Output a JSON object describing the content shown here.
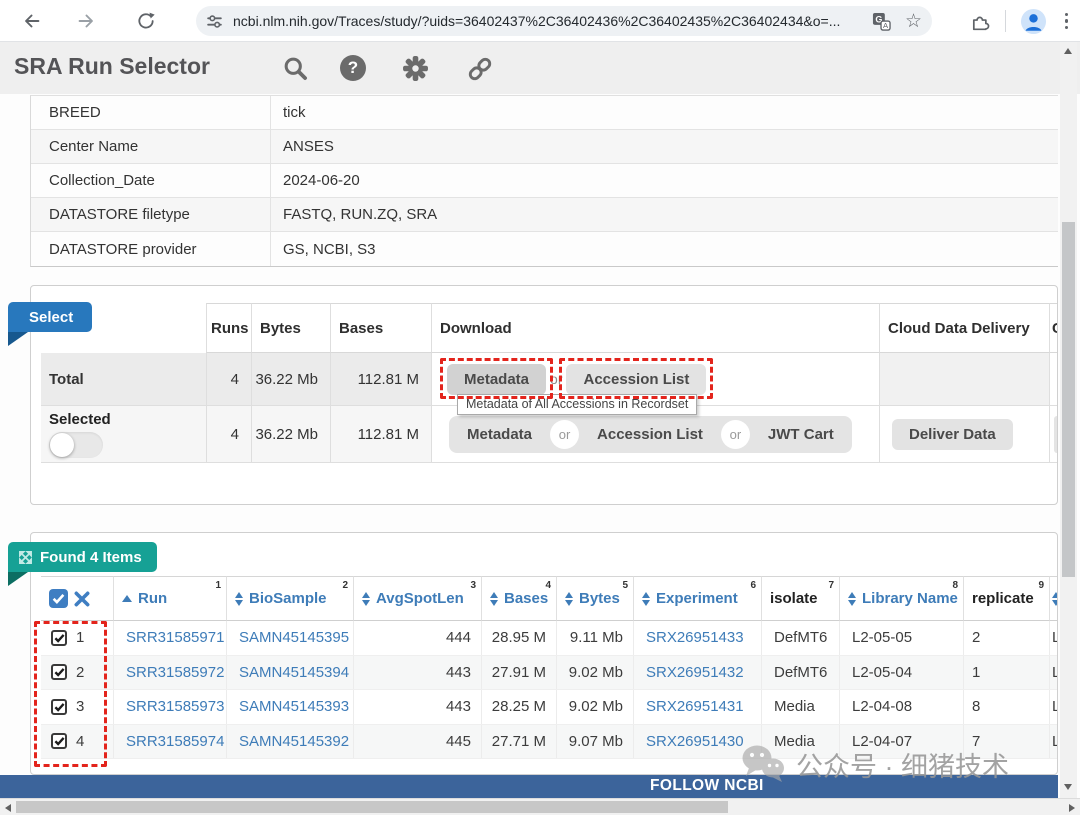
{
  "browser": {
    "url": "ncbi.nlm.nih.gov/Traces/study/?uids=36402437%2C36402436%2C36402435%2C36402434&o=...",
    "star_glyph": "☆"
  },
  "app_header": {
    "title": "SRA Run Selector",
    "help_glyph": "?"
  },
  "metadata_table": {
    "rows": [
      {
        "name": "BREED",
        "value": "tick"
      },
      {
        "name": "Center Name",
        "value": "ANSES"
      },
      {
        "name": "Collection_Date",
        "value": "2024-06-20"
      },
      {
        "name": "DATASTORE filetype",
        "value": "FASTQ, RUN.ZQ, SRA"
      },
      {
        "name": "DATASTORE provider",
        "value": "GS, NCBI, S3"
      }
    ]
  },
  "select_panel": {
    "ribbon": "Select",
    "headers": {
      "runs": "Runs",
      "bytes": "Bytes",
      "bases": "Bases",
      "download": "Download",
      "cloud": "Cloud Data Delivery",
      "partial": "C"
    },
    "total": {
      "label": "Total",
      "runs": "4",
      "bytes": "36.22 Mb",
      "bases": "112.81 M"
    },
    "selected": {
      "label": "Selected",
      "runs": "4",
      "bytes": "36.22 Mb",
      "bases": "112.81 M"
    },
    "buttons": {
      "metadata": "Metadata",
      "accession_list": "Accession List",
      "jwt_cart": "JWT Cart",
      "deliver_data": "Deliver Data",
      "or": "or"
    },
    "tooltip": "Metadata of All Accessions in Recordset"
  },
  "results_panel": {
    "ribbon": "Found 4 Items",
    "columns": [
      {
        "label": "Run",
        "sup": "1"
      },
      {
        "label": "BioSample",
        "sup": "2"
      },
      {
        "label": "AvgSpotLen",
        "sup": "3"
      },
      {
        "label": "Bases",
        "sup": "4"
      },
      {
        "label": "Bytes",
        "sup": "5"
      },
      {
        "label": "Experiment",
        "sup": "6"
      },
      {
        "label": "isolate",
        "sup": "7"
      },
      {
        "label": "Library Name",
        "sup": "8"
      },
      {
        "label": "replicate",
        "sup": "9"
      }
    ],
    "rows": [
      {
        "num": "1",
        "run": "SRR31585971",
        "biosample": "SAMN45145395",
        "avgspotlen": "444",
        "bases": "28.95 M",
        "bytes": "9.11 Mb",
        "experiment": "SRX26951433",
        "isolate": "DefMT6",
        "library_name": "L2-05-05",
        "replicate": "2",
        "clipped": "L"
      },
      {
        "num": "2",
        "run": "SRR31585972",
        "biosample": "SAMN45145394",
        "avgspotlen": "443",
        "bases": "27.91 M",
        "bytes": "9.02 Mb",
        "experiment": "SRX26951432",
        "isolate": "DefMT6",
        "library_name": "L2-05-04",
        "replicate": "1",
        "clipped": "L"
      },
      {
        "num": "3",
        "run": "SRR31585973",
        "biosample": "SAMN45145393",
        "avgspotlen": "443",
        "bases": "28.25 M",
        "bytes": "9.02 Mb",
        "experiment": "SRX26951431",
        "isolate": "Media",
        "library_name": "L2-04-08",
        "replicate": "8",
        "clipped": "L"
      },
      {
        "num": "4",
        "run": "SRR31585974",
        "biosample": "SAMN45145392",
        "avgspotlen": "445",
        "bases": "27.71 M",
        "bytes": "9.07 Mb",
        "experiment": "SRX26951430",
        "isolate": "Media",
        "library_name": "L2-04-07",
        "replicate": "7",
        "clipped": "L"
      }
    ]
  },
  "footer": {
    "label": "FOLLOW NCBI"
  },
  "watermark": {
    "text": "公众号 · 细猪技术"
  },
  "colors": {
    "select_ribbon": "#2878bd",
    "found_ribbon": "#16a195",
    "link_blue": "#3e7cb8",
    "highlight_red": "#e3241c",
    "footer_bar": "#3c649b"
  }
}
